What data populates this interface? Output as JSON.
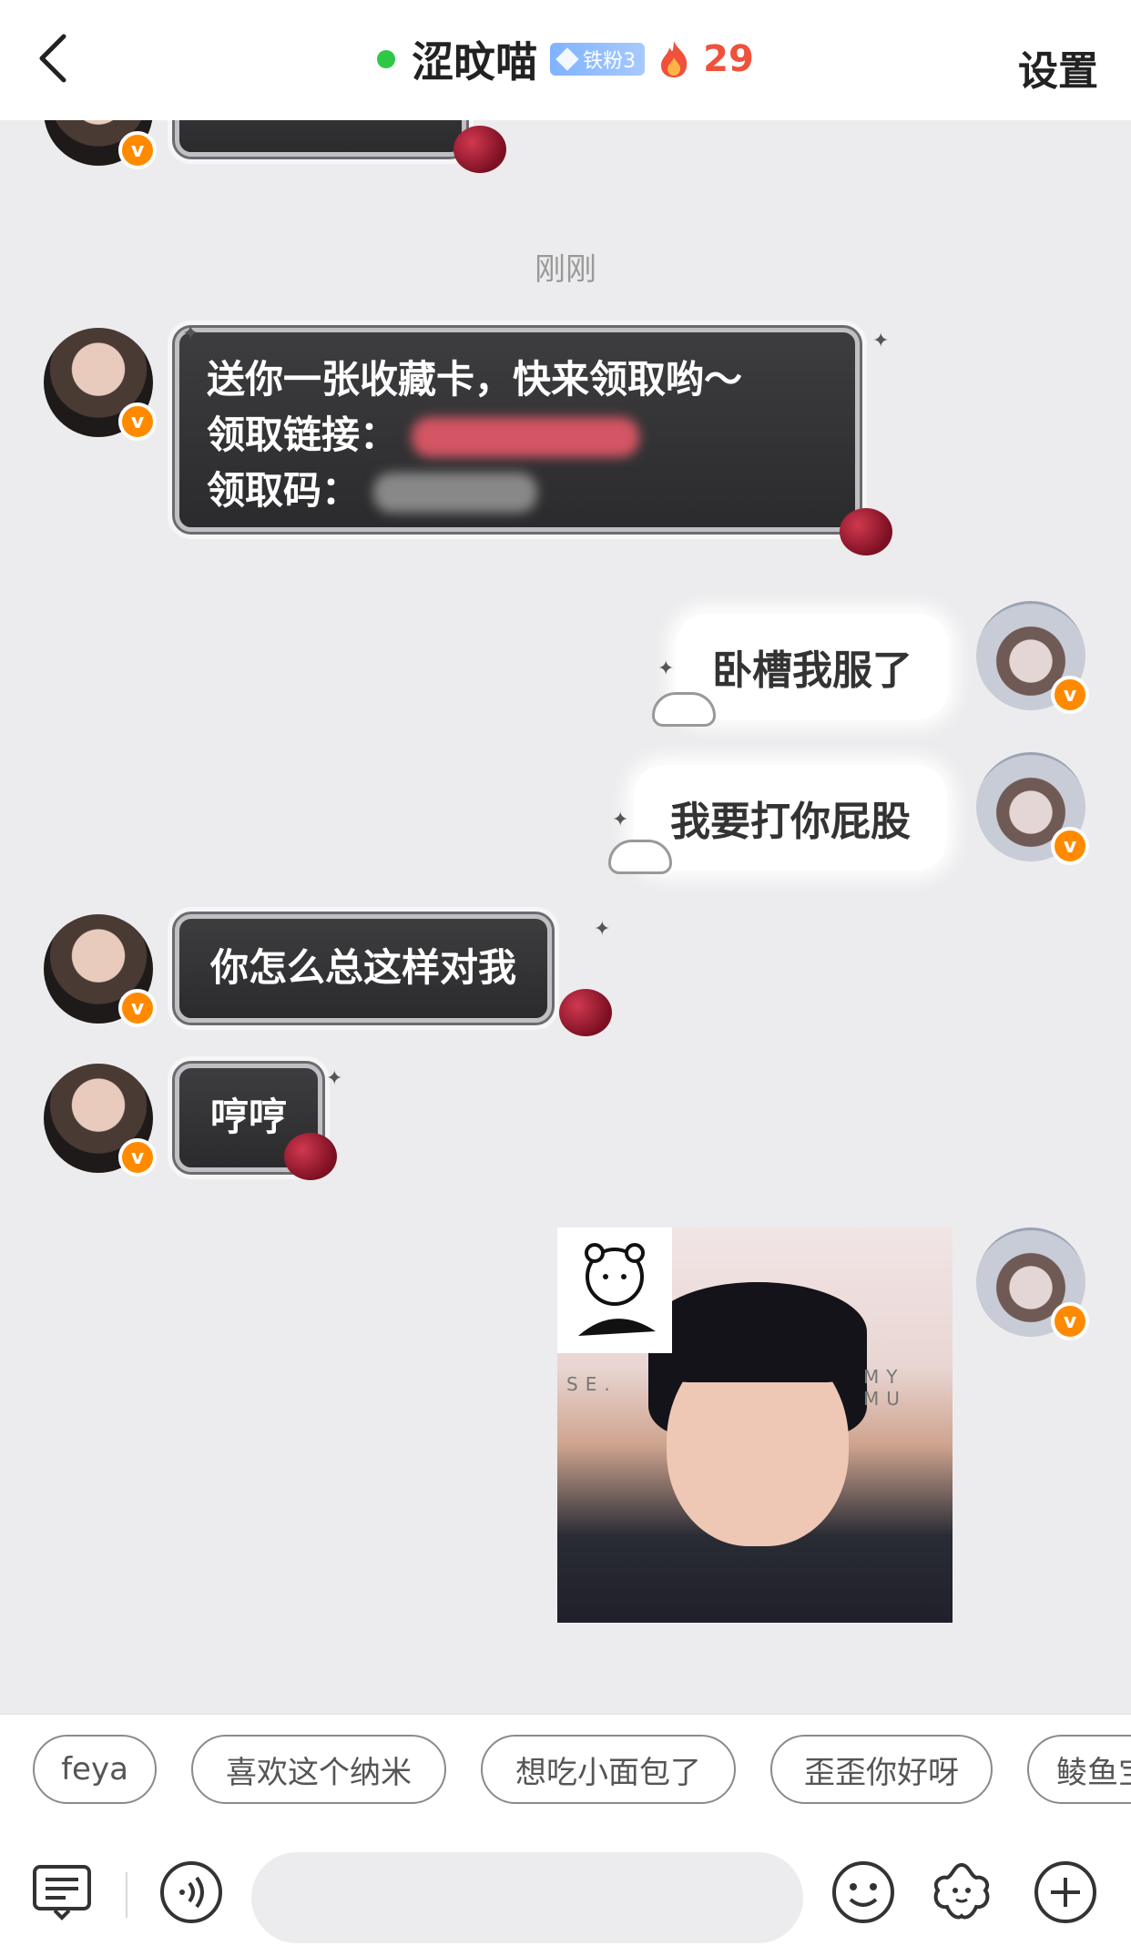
{
  "header": {
    "title": "涩旼喵",
    "fan_badge": "铁粉3",
    "streak_count": "29",
    "settings_label": "设置"
  },
  "chat": {
    "time_divider": "刚刚",
    "messages": [
      {
        "side": "left",
        "lines": [
          "送你一张收藏卡，快来领取哟～",
          "领取链接：",
          "领取码："
        ]
      },
      {
        "side": "right",
        "text": "卧槽我服了"
      },
      {
        "side": "right",
        "text": "我要打你屁股"
      },
      {
        "side": "left",
        "text": "你怎么总这样对我"
      },
      {
        "side": "left",
        "text": "哼哼"
      }
    ],
    "sticker_wall_text_left": "SE.",
    "sticker_wall_text_right": "MY MU"
  },
  "quick_replies": [
    "feya",
    "喜欢这个纳米",
    "想吃小面包了",
    "歪歪你好呀",
    "鲮鱼宝"
  ],
  "input": {
    "placeholder": ""
  },
  "colors": {
    "accent_orange": "#ff8a00",
    "online_green": "#2fc845",
    "streak_red": "#f0513a"
  }
}
